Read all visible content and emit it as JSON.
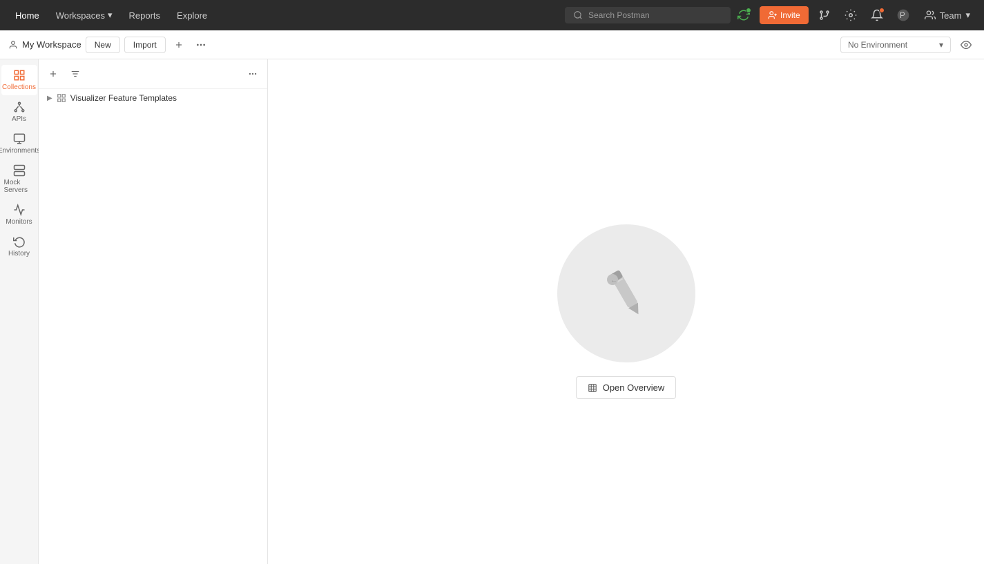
{
  "navbar": {
    "items": [
      {
        "id": "home",
        "label": "Home",
        "active": false
      },
      {
        "id": "workspaces",
        "label": "Workspaces",
        "active": false,
        "hasArrow": true
      },
      {
        "id": "reports",
        "label": "Reports",
        "active": false
      },
      {
        "id": "explore",
        "label": "Explore",
        "active": false
      }
    ],
    "search_placeholder": "Search Postman",
    "invite_label": "Invite",
    "team_label": "Team"
  },
  "workspace_bar": {
    "workspace_icon": "user",
    "workspace_name": "My Workspace",
    "new_label": "New",
    "import_label": "Import",
    "env_placeholder": "No Environment"
  },
  "sidebar": {
    "items": [
      {
        "id": "collections",
        "label": "Collections",
        "active": true,
        "icon": "collections"
      },
      {
        "id": "apis",
        "label": "APIs",
        "active": false,
        "icon": "apis"
      },
      {
        "id": "environments",
        "label": "Environments",
        "active": false,
        "icon": "environments"
      },
      {
        "id": "mock-servers",
        "label": "Mock Servers",
        "active": false,
        "icon": "mock-servers"
      },
      {
        "id": "monitors",
        "label": "Monitors",
        "active": false,
        "icon": "monitors"
      },
      {
        "id": "history",
        "label": "History",
        "active": false,
        "icon": "history"
      }
    ]
  },
  "collections_panel": {
    "collections": [
      {
        "name": "Visualizer Feature Templates"
      }
    ]
  },
  "main": {
    "open_overview_label": "Open Overview"
  }
}
